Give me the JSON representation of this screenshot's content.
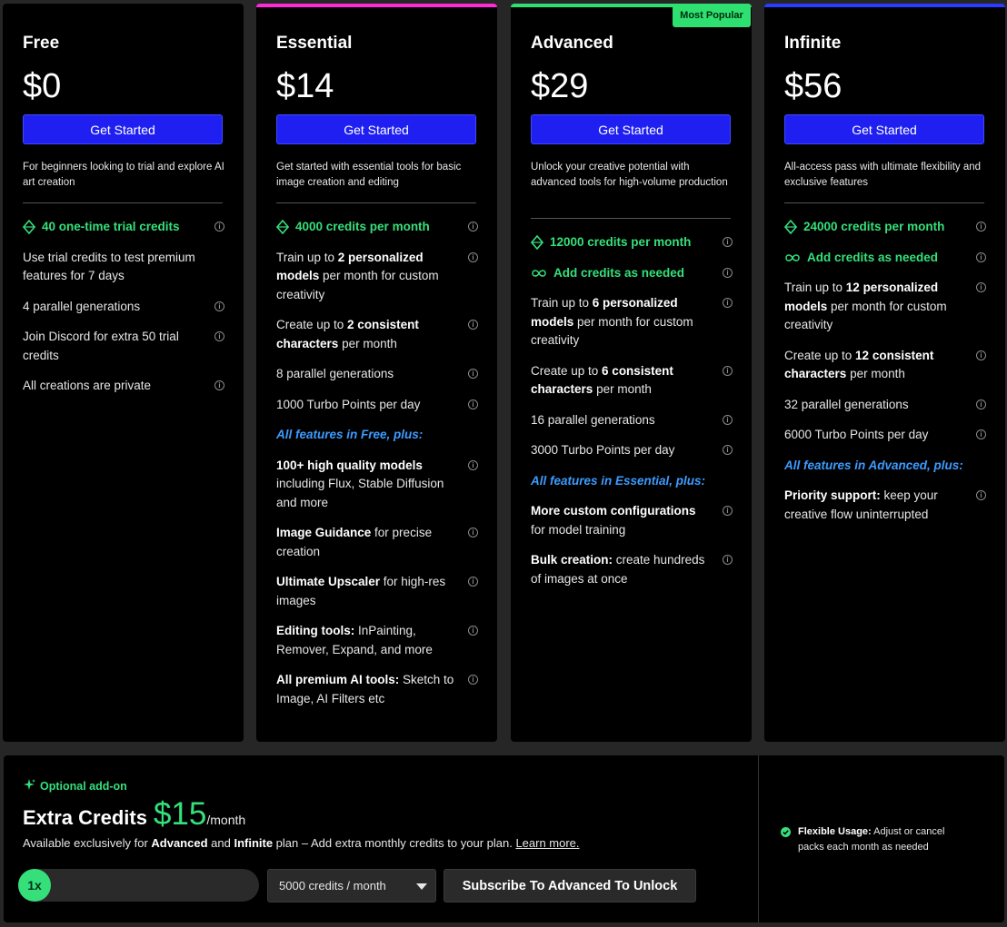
{
  "plans": [
    {
      "name": "Free",
      "price": "$0",
      "cta": "Get Started",
      "description": "For beginners looking to trial and explore AI art creation",
      "credits": "40 one-time trial credits",
      "features": [
        "Use trial credits to test premium features for 7 days",
        "4 parallel generations",
        "Join Discord for extra 50 trial credits",
        "All creations are private"
      ]
    },
    {
      "name": "Essential",
      "price": "$14",
      "cta": "Get Started",
      "accent": "#ff2bd6",
      "description": "Get started with essential tools for basic image creation and editing",
      "credits": "4000 credits per month",
      "f1_pre": "Train up to ",
      "f1_bold": "2 personalized models",
      "f1_post": " per month for custom creativity",
      "f2_pre": "Create up to ",
      "f2_bold": "2 consistent characters",
      "f2_post": " per month",
      "f3": "8 parallel generations",
      "f4": "1000 Turbo Points per day",
      "section": "All features in Free, plus:",
      "e1_bold": "100+ high quality models",
      "e1_post": " including Flux, Stable Diffusion and more",
      "e2_bold": "Image Guidance",
      "e2_post": " for precise creation",
      "e3_bold": "Ultimate Upscaler",
      "e3_post": " for high-res images",
      "e4_bold": "Editing tools:",
      "e4_post": " InPainting, Remover, Expand, and more",
      "e5_bold": "All premium AI tools:",
      "e5_post": " Sketch to Image, AI Filters etc"
    },
    {
      "name": "Advanced",
      "price": "$29",
      "cta": "Get Started",
      "accent": "#2ee06f",
      "badge": "Most Popular",
      "description": "Unlock your creative potential with advanced tools for high-volume production",
      "credits": "12000 credits per month",
      "add_credits": "Add credits as needed",
      "f1_pre": "Train up to ",
      "f1_bold": "6 personalized models",
      "f1_post": " per month for custom creativity",
      "f2_pre": "Create up to ",
      "f2_bold": "6 consistent characters",
      "f2_post": " per month",
      "f3": "16 parallel generations",
      "f4": "3000 Turbo Points per day",
      "section": "All features in Essential, plus:",
      "e1_bold": "More custom configurations",
      "e1_post": " for model training",
      "e2_bold": "Bulk creation:",
      "e2_post": " create hundreds of images at once"
    },
    {
      "name": "Infinite",
      "price": "$56",
      "cta": "Get Started",
      "accent": "#2b3bff",
      "description": "All-access pass with ultimate flexibility and exclusive features",
      "credits": "24000 credits per month",
      "add_credits": "Add credits as needed",
      "f1_pre": "Train up to ",
      "f1_bold": "12 personalized models",
      "f1_post": " per month for custom creativity",
      "f2_pre": "Create up to ",
      "f2_bold": "12 consistent characters",
      "f2_post": " per month",
      "f3": "32 parallel generations",
      "f4": "6000 Turbo Points per day",
      "section": "All features in Advanced, plus:",
      "e1_bold": "Priority support:",
      "e1_post": " keep your creative flow uninterrupted"
    }
  ],
  "addon": {
    "label": "Optional add-on",
    "title": "Extra Credits",
    "price": "$15",
    "per": "/month",
    "desc_pre": "Available exclusively for ",
    "desc_b1": "Advanced",
    "desc_mid": " and ",
    "desc_b2": "Infinite",
    "desc_post": " plan – Add extra monthly credits to your plan. ",
    "learn_more": "Learn more.",
    "multiplier": "1x",
    "select_value": "5000 credits / month",
    "subscribe": "Subscribe To Advanced To Unlock",
    "note_bold": "Flexible Usage:",
    "note_text": " Adjust or cancel packs each month as needed"
  },
  "colors": {
    "green": "#35e07a",
    "blue_button": "#1f1ff2",
    "section_blue": "#3d9bff",
    "card_bg": "#000000",
    "page_bg": "#262626"
  },
  "icons": {
    "credits": "diamond-icon",
    "add_credits": "infinity-icon",
    "info": "info-icon",
    "sparkle": "sparkle-icon",
    "check": "check-circle-icon",
    "caret": "chevron-down-icon"
  }
}
